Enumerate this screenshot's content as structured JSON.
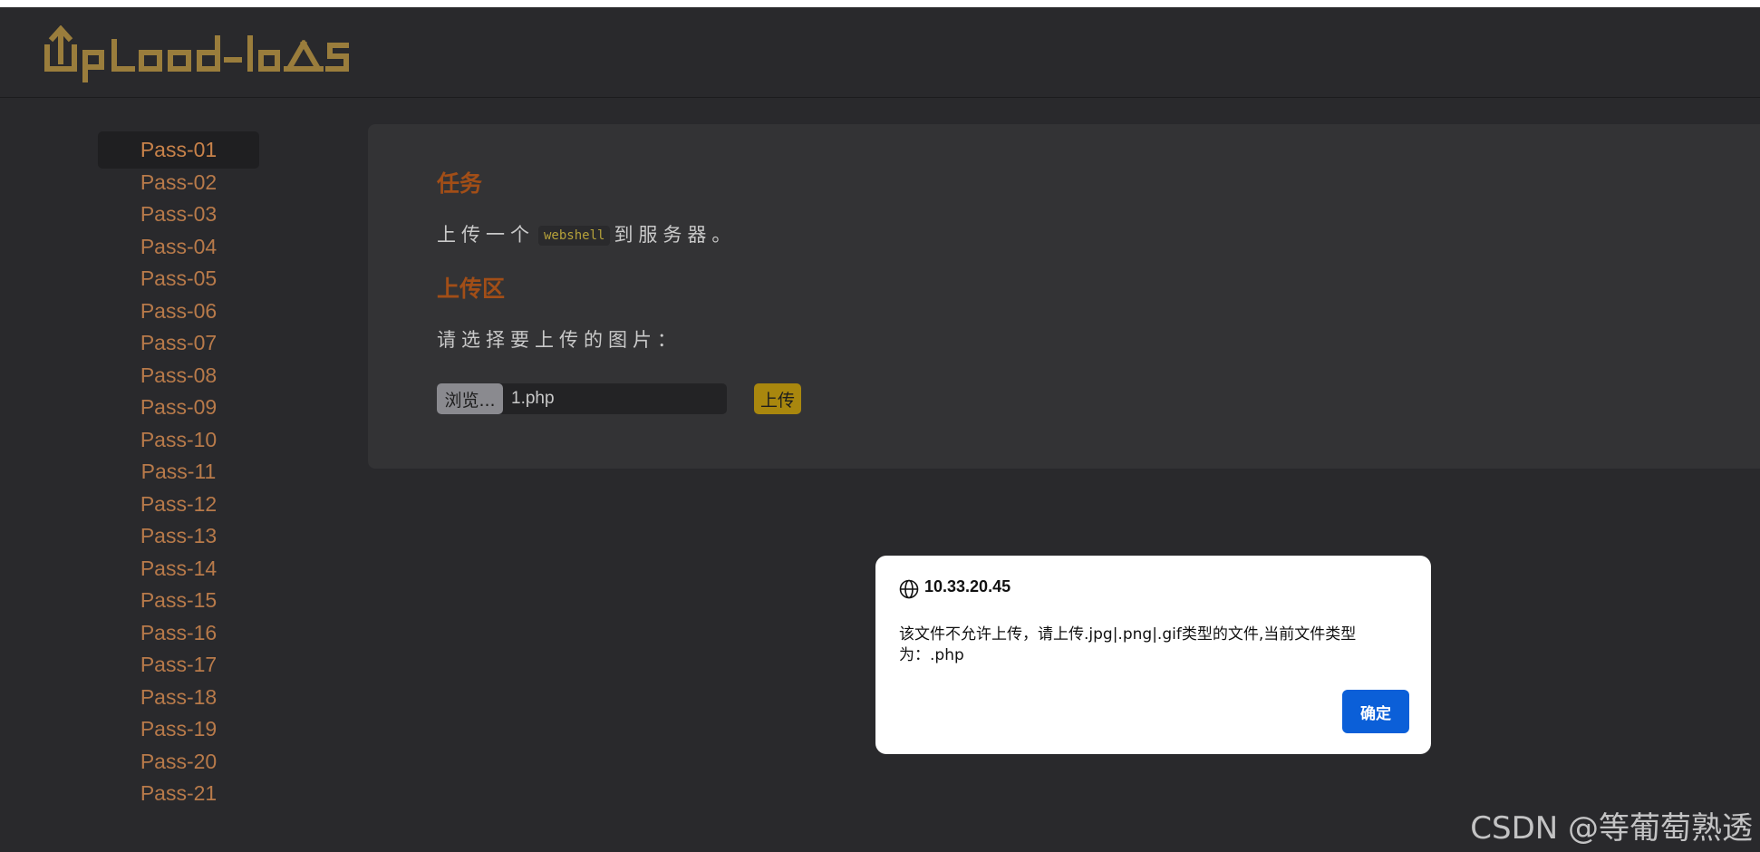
{
  "header": {
    "logo_text": "UpLoad-labS"
  },
  "sidebar": {
    "items": [
      {
        "label": "Pass-01"
      },
      {
        "label": "Pass-02"
      },
      {
        "label": "Pass-03"
      },
      {
        "label": "Pass-04"
      },
      {
        "label": "Pass-05"
      },
      {
        "label": "Pass-06"
      },
      {
        "label": "Pass-07"
      },
      {
        "label": "Pass-08"
      },
      {
        "label": "Pass-09"
      },
      {
        "label": "Pass-10"
      },
      {
        "label": "Pass-11"
      },
      {
        "label": "Pass-12"
      },
      {
        "label": "Pass-13"
      },
      {
        "label": "Pass-14"
      },
      {
        "label": "Pass-15"
      },
      {
        "label": "Pass-16"
      },
      {
        "label": "Pass-17"
      },
      {
        "label": "Pass-18"
      },
      {
        "label": "Pass-19"
      },
      {
        "label": "Pass-20"
      },
      {
        "label": "Pass-21"
      }
    ],
    "active_index": 0
  },
  "main": {
    "task_title": "任务",
    "task_prefix": "上传一个",
    "task_code": "webshell",
    "task_suffix": "到服务器。",
    "upload_title": "上传区",
    "upload_prompt": "请选择要上传的图片：",
    "browse_label": "浏览...",
    "file_name": "1.php",
    "upload_label": "上传"
  },
  "dialog": {
    "host": "10.33.20.45",
    "message": "该文件不允许上传，请上传.jpg|.png|.gif类型的文件,当前文件类型为：.php",
    "ok_label": "确定"
  },
  "watermark": "CSDN @等葡萄熟透",
  "colors": {
    "background": "#29292c",
    "panel": "#333335",
    "accent_orange": "#a24e17",
    "nav_text": "#b87a4a",
    "upload_button": "#a9870e",
    "dialog_button": "#0b5fd8"
  }
}
